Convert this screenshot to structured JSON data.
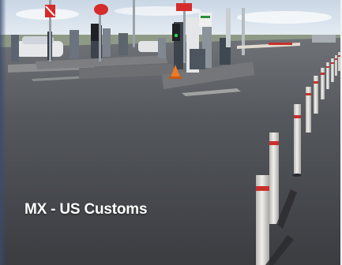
{
  "card": {
    "caption": "MX - US Customs"
  },
  "colors": {
    "sky": "#d7e3ee",
    "asphalt": "#4a4d52",
    "bollard_white": "#e6e4e1",
    "bollard_band": "#c8312a",
    "sign_red": "#d62b2b"
  }
}
